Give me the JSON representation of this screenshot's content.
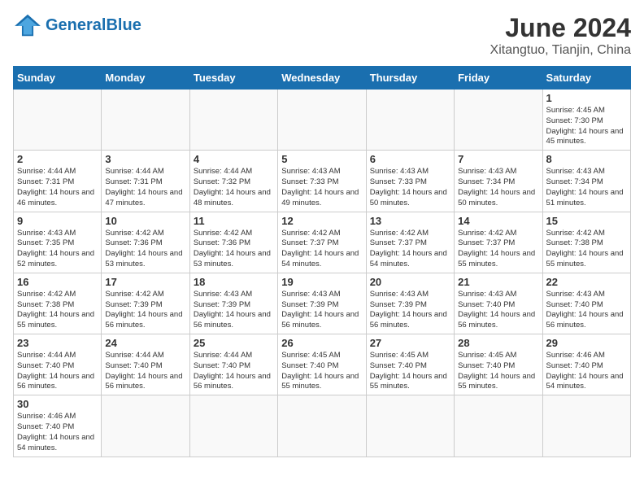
{
  "header": {
    "logo_general": "General",
    "logo_blue": "Blue",
    "title": "June 2024",
    "subtitle": "Xitangtuo, Tianjin, China"
  },
  "weekdays": [
    "Sunday",
    "Monday",
    "Tuesday",
    "Wednesday",
    "Thursday",
    "Friday",
    "Saturday"
  ],
  "weeks": [
    [
      {
        "day": "",
        "info": ""
      },
      {
        "day": "",
        "info": ""
      },
      {
        "day": "",
        "info": ""
      },
      {
        "day": "",
        "info": ""
      },
      {
        "day": "",
        "info": ""
      },
      {
        "day": "",
        "info": ""
      },
      {
        "day": "1",
        "info": "Sunrise: 4:45 AM\nSunset: 7:30 PM\nDaylight: 14 hours and 45 minutes."
      }
    ],
    [
      {
        "day": "2",
        "info": "Sunrise: 4:44 AM\nSunset: 7:31 PM\nDaylight: 14 hours and 46 minutes."
      },
      {
        "day": "3",
        "info": "Sunrise: 4:44 AM\nSunset: 7:31 PM\nDaylight: 14 hours and 47 minutes."
      },
      {
        "day": "4",
        "info": "Sunrise: 4:44 AM\nSunset: 7:32 PM\nDaylight: 14 hours and 48 minutes."
      },
      {
        "day": "5",
        "info": "Sunrise: 4:43 AM\nSunset: 7:33 PM\nDaylight: 14 hours and 49 minutes."
      },
      {
        "day": "6",
        "info": "Sunrise: 4:43 AM\nSunset: 7:33 PM\nDaylight: 14 hours and 50 minutes."
      },
      {
        "day": "7",
        "info": "Sunrise: 4:43 AM\nSunset: 7:34 PM\nDaylight: 14 hours and 50 minutes."
      },
      {
        "day": "8",
        "info": "Sunrise: 4:43 AM\nSunset: 7:34 PM\nDaylight: 14 hours and 51 minutes."
      }
    ],
    [
      {
        "day": "9",
        "info": "Sunrise: 4:43 AM\nSunset: 7:35 PM\nDaylight: 14 hours and 52 minutes."
      },
      {
        "day": "10",
        "info": "Sunrise: 4:42 AM\nSunset: 7:36 PM\nDaylight: 14 hours and 53 minutes."
      },
      {
        "day": "11",
        "info": "Sunrise: 4:42 AM\nSunset: 7:36 PM\nDaylight: 14 hours and 53 minutes."
      },
      {
        "day": "12",
        "info": "Sunrise: 4:42 AM\nSunset: 7:37 PM\nDaylight: 14 hours and 54 minutes."
      },
      {
        "day": "13",
        "info": "Sunrise: 4:42 AM\nSunset: 7:37 PM\nDaylight: 14 hours and 54 minutes."
      },
      {
        "day": "14",
        "info": "Sunrise: 4:42 AM\nSunset: 7:37 PM\nDaylight: 14 hours and 55 minutes."
      },
      {
        "day": "15",
        "info": "Sunrise: 4:42 AM\nSunset: 7:38 PM\nDaylight: 14 hours and 55 minutes."
      }
    ],
    [
      {
        "day": "16",
        "info": "Sunrise: 4:42 AM\nSunset: 7:38 PM\nDaylight: 14 hours and 55 minutes."
      },
      {
        "day": "17",
        "info": "Sunrise: 4:42 AM\nSunset: 7:39 PM\nDaylight: 14 hours and 56 minutes."
      },
      {
        "day": "18",
        "info": "Sunrise: 4:43 AM\nSunset: 7:39 PM\nDaylight: 14 hours and 56 minutes."
      },
      {
        "day": "19",
        "info": "Sunrise: 4:43 AM\nSunset: 7:39 PM\nDaylight: 14 hours and 56 minutes."
      },
      {
        "day": "20",
        "info": "Sunrise: 4:43 AM\nSunset: 7:39 PM\nDaylight: 14 hours and 56 minutes."
      },
      {
        "day": "21",
        "info": "Sunrise: 4:43 AM\nSunset: 7:40 PM\nDaylight: 14 hours and 56 minutes."
      },
      {
        "day": "22",
        "info": "Sunrise: 4:43 AM\nSunset: 7:40 PM\nDaylight: 14 hours and 56 minutes."
      }
    ],
    [
      {
        "day": "23",
        "info": "Sunrise: 4:44 AM\nSunset: 7:40 PM\nDaylight: 14 hours and 56 minutes."
      },
      {
        "day": "24",
        "info": "Sunrise: 4:44 AM\nSunset: 7:40 PM\nDaylight: 14 hours and 56 minutes."
      },
      {
        "day": "25",
        "info": "Sunrise: 4:44 AM\nSunset: 7:40 PM\nDaylight: 14 hours and 56 minutes."
      },
      {
        "day": "26",
        "info": "Sunrise: 4:45 AM\nSunset: 7:40 PM\nDaylight: 14 hours and 55 minutes."
      },
      {
        "day": "27",
        "info": "Sunrise: 4:45 AM\nSunset: 7:40 PM\nDaylight: 14 hours and 55 minutes."
      },
      {
        "day": "28",
        "info": "Sunrise: 4:45 AM\nSunset: 7:40 PM\nDaylight: 14 hours and 55 minutes."
      },
      {
        "day": "29",
        "info": "Sunrise: 4:46 AM\nSunset: 7:40 PM\nDaylight: 14 hours and 54 minutes."
      }
    ],
    [
      {
        "day": "30",
        "info": "Sunrise: 4:46 AM\nSunset: 7:40 PM\nDaylight: 14 hours and 54 minutes."
      },
      {
        "day": "",
        "info": ""
      },
      {
        "day": "",
        "info": ""
      },
      {
        "day": "",
        "info": ""
      },
      {
        "day": "",
        "info": ""
      },
      {
        "day": "",
        "info": ""
      },
      {
        "day": "",
        "info": ""
      }
    ]
  ]
}
